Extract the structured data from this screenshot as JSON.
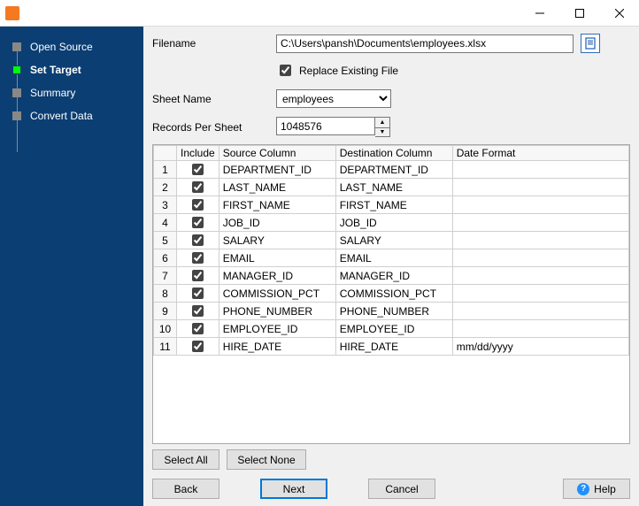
{
  "sidebar": {
    "items": [
      {
        "label": "Open Source"
      },
      {
        "label": "Set Target"
      },
      {
        "label": "Summary"
      },
      {
        "label": "Convert Data"
      }
    ],
    "active_index": 1
  },
  "form": {
    "filename_label": "Filename",
    "filename_value": "C:\\Users\\pansh\\Documents\\employees.xlsx",
    "replace_label": "Replace Existing File",
    "replace_checked": true,
    "sheet_label": "Sheet Name",
    "sheet_selected": "employees",
    "records_label": "Records Per Sheet",
    "records_value": "1048576"
  },
  "grid": {
    "headers": {
      "include": "Include",
      "source": "Source Column",
      "dest": "Destination Column",
      "format": "Date Format"
    },
    "rows": [
      {
        "n": "1",
        "inc": true,
        "src": "DEPARTMENT_ID",
        "dst": "DEPARTMENT_ID",
        "fmt": ""
      },
      {
        "n": "2",
        "inc": true,
        "src": "LAST_NAME",
        "dst": "LAST_NAME",
        "fmt": ""
      },
      {
        "n": "3",
        "inc": true,
        "src": "FIRST_NAME",
        "dst": "FIRST_NAME",
        "fmt": ""
      },
      {
        "n": "4",
        "inc": true,
        "src": "JOB_ID",
        "dst": "JOB_ID",
        "fmt": ""
      },
      {
        "n": "5",
        "inc": true,
        "src": "SALARY",
        "dst": "SALARY",
        "fmt": ""
      },
      {
        "n": "6",
        "inc": true,
        "src": "EMAIL",
        "dst": "EMAIL",
        "fmt": ""
      },
      {
        "n": "7",
        "inc": true,
        "src": "MANAGER_ID",
        "dst": "MANAGER_ID",
        "fmt": ""
      },
      {
        "n": "8",
        "inc": true,
        "src": "COMMISSION_PCT",
        "dst": "COMMISSION_PCT",
        "fmt": ""
      },
      {
        "n": "9",
        "inc": true,
        "src": "PHONE_NUMBER",
        "dst": "PHONE_NUMBER",
        "fmt": ""
      },
      {
        "n": "10",
        "inc": true,
        "src": "EMPLOYEE_ID",
        "dst": "EMPLOYEE_ID",
        "fmt": ""
      },
      {
        "n": "11",
        "inc": true,
        "src": "HIRE_DATE",
        "dst": "HIRE_DATE",
        "fmt": "mm/dd/yyyy"
      }
    ]
  },
  "buttons": {
    "select_all": "Select All",
    "select_none": "Select None",
    "back": "Back",
    "next": "Next",
    "cancel": "Cancel",
    "help": "Help"
  }
}
